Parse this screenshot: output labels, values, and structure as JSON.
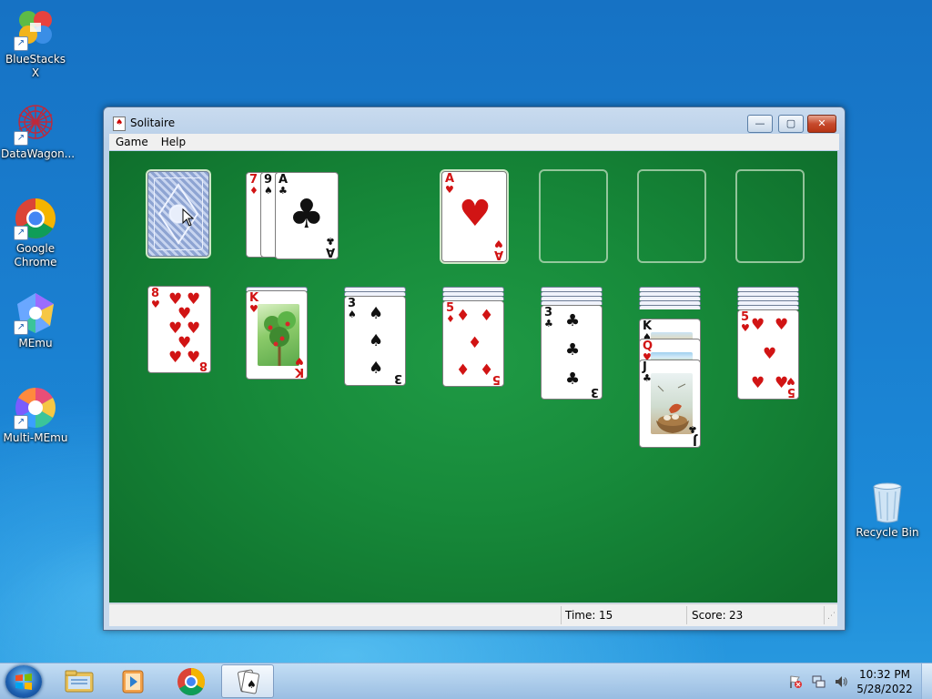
{
  "desktop": {
    "icons": [
      {
        "label": "BlueStacks X",
        "icon": "bluestacks-icon"
      },
      {
        "label": "DataWagon...",
        "icon": "datawagon-icon"
      },
      {
        "label": "Google Chrome",
        "icon": "chrome-icon"
      },
      {
        "label": "MEmu",
        "icon": "memu-icon"
      },
      {
        "label": "Multi-MEmu",
        "icon": "multi-memu-icon"
      },
      {
        "label": "Recycle Bin",
        "icon": "recycle-bin-icon"
      }
    ],
    "shortcut_glyph": "↗"
  },
  "window": {
    "title": "Solitaire",
    "app_icon_glyph": "♠",
    "buttons": {
      "minimize": "—",
      "maximize": "▢",
      "close": "✕"
    },
    "menu": [
      "Game",
      "Help"
    ],
    "status": {
      "time_label": "Time:",
      "time_value": "15",
      "score_label": "Score:",
      "score_value": "23"
    }
  },
  "game": {
    "stock": {
      "face_down": true
    },
    "waste": [
      {
        "rank": "7",
        "suit": "♦",
        "color": "red"
      },
      {
        "rank": "9",
        "suit": "♠",
        "color": "black"
      },
      {
        "rank": "A",
        "suit": "♣",
        "color": "black"
      }
    ],
    "foundations": [
      {
        "rank": "A",
        "suit": "♥",
        "color": "red"
      },
      null,
      null,
      null
    ],
    "tableau": [
      {
        "hidden": 0,
        "cards": [
          {
            "rank": "8",
            "suit": "♥",
            "color": "red"
          }
        ]
      },
      {
        "hidden": 1,
        "cards": [
          {
            "rank": "K",
            "suit": "♥",
            "color": "red"
          }
        ]
      },
      {
        "hidden": 2,
        "cards": [
          {
            "rank": "3",
            "suit": "♠",
            "color": "black"
          }
        ]
      },
      {
        "hidden": 3,
        "cards": [
          {
            "rank": "5",
            "suit": "♦",
            "color": "red"
          }
        ]
      },
      {
        "hidden": 4,
        "cards": [
          {
            "rank": "3",
            "suit": "♣",
            "color": "black"
          }
        ]
      },
      {
        "hidden": 5,
        "cards": [
          {
            "rank": "K",
            "suit": "♠",
            "color": "black"
          },
          {
            "rank": "Q",
            "suit": "♥",
            "color": "red"
          },
          {
            "rank": "J",
            "suit": "♣",
            "color": "black"
          }
        ]
      },
      {
        "hidden": 6,
        "cards": [
          {
            "rank": "5",
            "suit": "♥",
            "color": "red"
          }
        ]
      }
    ]
  },
  "taskbar": {
    "items": [
      "windows-explorer-icon",
      "media-player-icon",
      "chrome-icon",
      "solitaire-icon"
    ],
    "tray_icons": [
      "action-center-flag-icon",
      "network-icon",
      "volume-icon"
    ],
    "clock_time": "10:32 PM",
    "clock_date": "5/28/2022"
  },
  "colors": {
    "felt": "#178a3a",
    "red_suit": "#d11414",
    "black_suit": "#111111"
  }
}
